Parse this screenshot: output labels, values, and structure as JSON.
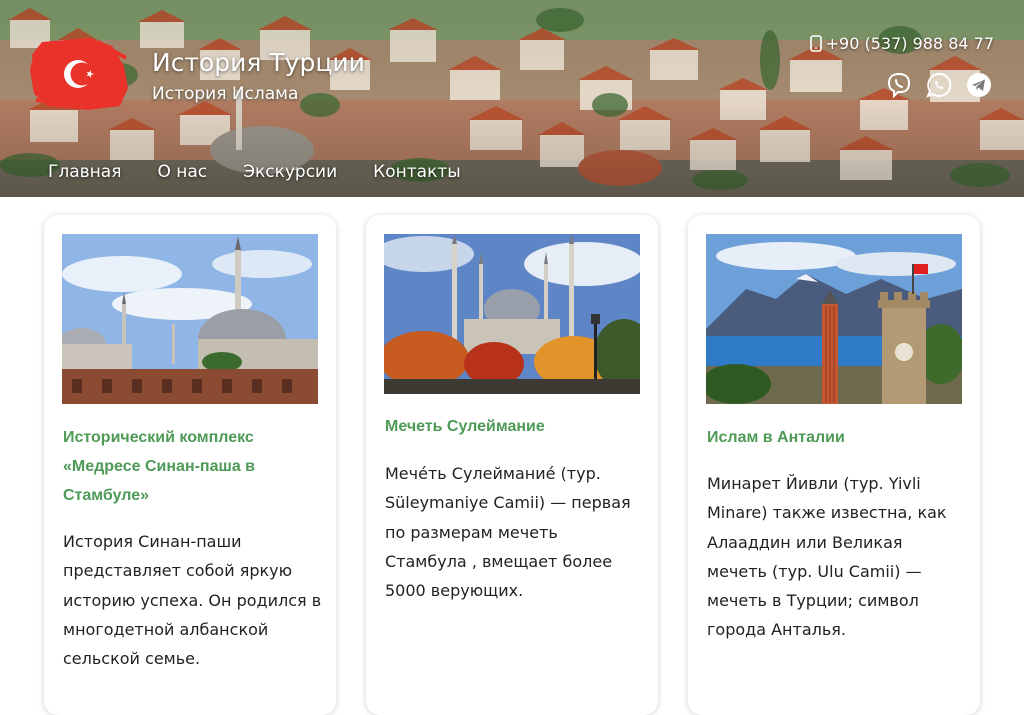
{
  "header": {
    "title": "История Турции",
    "subtitle": "История Ислама",
    "phone": "+90 (537) 988 84 77",
    "socials": [
      {
        "name": "viber-icon"
      },
      {
        "name": "whatsapp-icon"
      },
      {
        "name": "telegram-icon"
      }
    ],
    "nav": [
      "Главная",
      "О нас",
      "Экскурсии",
      "Контакты"
    ]
  },
  "colors": {
    "accent_green": "#4e9a57",
    "logo_red": "#e8322a"
  },
  "cards": [
    {
      "title": "Исторический комплекс «Медресе Синан-паша в Стамбуле»",
      "text": "История  Синан-паши представляет собой яркую историю успеха. Он родился в многодетной албанской сельской семье."
    },
    {
      "title": "Мечеть Сулеймание",
      "text": "Мече́ть Сулеймание́ (тур. Süleymaniye Camii) — первая по размерам мечеть Стамбула , вмещает более 5000 верующих."
    },
    {
      "title": "Ислам в Анталии",
      "text": "Минарет Йивли (тур. Yivli Minare) также известна, как Алааддин или Великая мечеть (тур. Ulu Camii) — мечеть в Турции; символ города Анталья."
    }
  ]
}
